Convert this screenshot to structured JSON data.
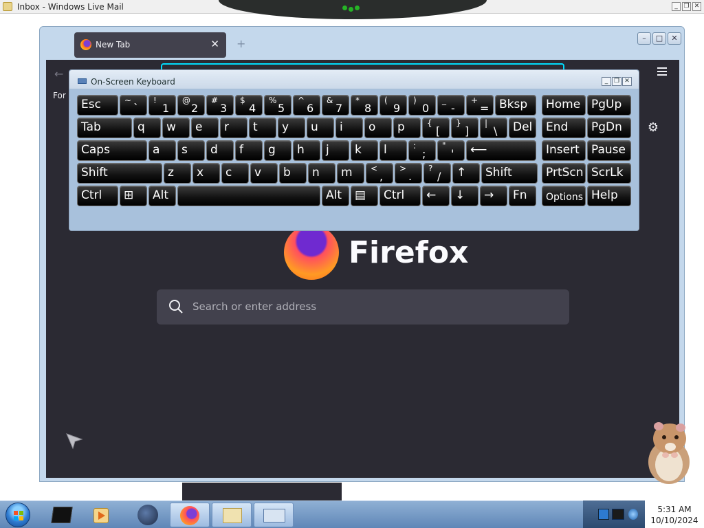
{
  "wlm": {
    "title": "Inbox - Windows Live Mail",
    "controls": [
      "minimize",
      "restore",
      "close"
    ]
  },
  "firefox": {
    "tab_title": "New Tab",
    "tab_close": "✕",
    "bookmarks_text": "For q",
    "wordmark": "Firefox",
    "search_placeholder": "Search or enter address",
    "back_icon": "arrow-left-icon",
    "menu_icon": "hamburger-menu-icon",
    "settings_icon": "gear-icon"
  },
  "osk": {
    "title": "On-Screen Keyboard",
    "rows": [
      [
        {
          "label": "Esc"
        },
        {
          "top": "~",
          "bot": "`"
        },
        {
          "top": "!",
          "bot": "1"
        },
        {
          "top": "@",
          "bot": "2"
        },
        {
          "top": "#",
          "bot": "3"
        },
        {
          "top": "$",
          "bot": "4"
        },
        {
          "top": "%",
          "bot": "5"
        },
        {
          "top": "^",
          "bot": "6"
        },
        {
          "top": "&",
          "bot": "7"
        },
        {
          "top": "*",
          "bot": "8"
        },
        {
          "top": "(",
          "bot": "9"
        },
        {
          "top": ")",
          "bot": "0"
        },
        {
          "top": "_",
          "bot": "-"
        },
        {
          "top": "+",
          "bot": "="
        },
        {
          "label": "Bksp"
        },
        {
          "label": "Home"
        },
        {
          "label": "PgUp"
        }
      ],
      [
        {
          "label": "Tab"
        },
        {
          "label": "q"
        },
        {
          "label": "w"
        },
        {
          "label": "e"
        },
        {
          "label": "r"
        },
        {
          "label": "t"
        },
        {
          "label": "y"
        },
        {
          "label": "u"
        },
        {
          "label": "i"
        },
        {
          "label": "o"
        },
        {
          "label": "p"
        },
        {
          "top": "{",
          "bot": "["
        },
        {
          "top": "}",
          "bot": "]"
        },
        {
          "top": "|",
          "bot": "\\"
        },
        {
          "label": "Del"
        },
        {
          "label": "End"
        },
        {
          "label": "PgDn"
        }
      ],
      [
        {
          "label": "Caps"
        },
        {
          "label": "a"
        },
        {
          "label": "s"
        },
        {
          "label": "d"
        },
        {
          "label": "f"
        },
        {
          "label": "g"
        },
        {
          "label": "h"
        },
        {
          "label": "j"
        },
        {
          "label": "k"
        },
        {
          "label": "l"
        },
        {
          "top": ":",
          "bot": ";"
        },
        {
          "top": "\"",
          "bot": "'"
        },
        {
          "label": "⟵"
        },
        {
          "label": "Insert"
        },
        {
          "label": "Pause"
        }
      ],
      [
        {
          "label": "Shift"
        },
        {
          "label": "z"
        },
        {
          "label": "x"
        },
        {
          "label": "c"
        },
        {
          "label": "v"
        },
        {
          "label": "b"
        },
        {
          "label": "n"
        },
        {
          "label": "m"
        },
        {
          "top": "<",
          "bot": ","
        },
        {
          "top": ">",
          "bot": "."
        },
        {
          "top": "?",
          "bot": "/"
        },
        {
          "label": "↑"
        },
        {
          "label": "Shift"
        },
        {
          "label": "PrtScn"
        },
        {
          "label": "ScrLk"
        }
      ],
      [
        {
          "label": "Ctrl"
        },
        {
          "label": "⊞"
        },
        {
          "label": "Alt"
        },
        {
          "label": ""
        },
        {
          "label": "Alt"
        },
        {
          "label": "▤"
        },
        {
          "label": "Ctrl"
        },
        {
          "label": "←"
        },
        {
          "label": "↓"
        },
        {
          "label": "→"
        },
        {
          "label": "Fn"
        },
        {
          "label": "Options"
        },
        {
          "label": "Help"
        }
      ]
    ]
  },
  "taskbar": {
    "clock_time": "5:31 AM",
    "clock_date": "10/10/2024"
  }
}
